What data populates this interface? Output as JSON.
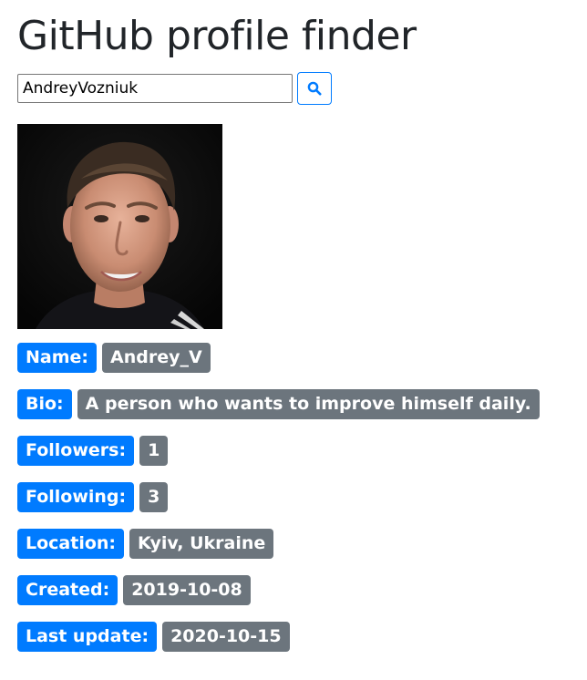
{
  "app": {
    "title": "GitHub profile finder"
  },
  "search": {
    "value": "AndreyVozniuk",
    "button_icon": "search-icon"
  },
  "colors": {
    "label_badge": "#007bff",
    "value_badge": "#6c757d"
  },
  "profile": {
    "fields": [
      {
        "label": "Name:",
        "value": "Andrey_V"
      },
      {
        "label": "Bio:",
        "value": "A person who wants to improve himself daily."
      },
      {
        "label": "Followers:",
        "value": "1"
      },
      {
        "label": "Following:",
        "value": "3"
      },
      {
        "label": "Location:",
        "value": "Kyiv, Ukraine"
      },
      {
        "label": "Created:",
        "value": "2019-10-08"
      },
      {
        "label": "Last update:",
        "value": "2020-10-15"
      }
    ]
  }
}
